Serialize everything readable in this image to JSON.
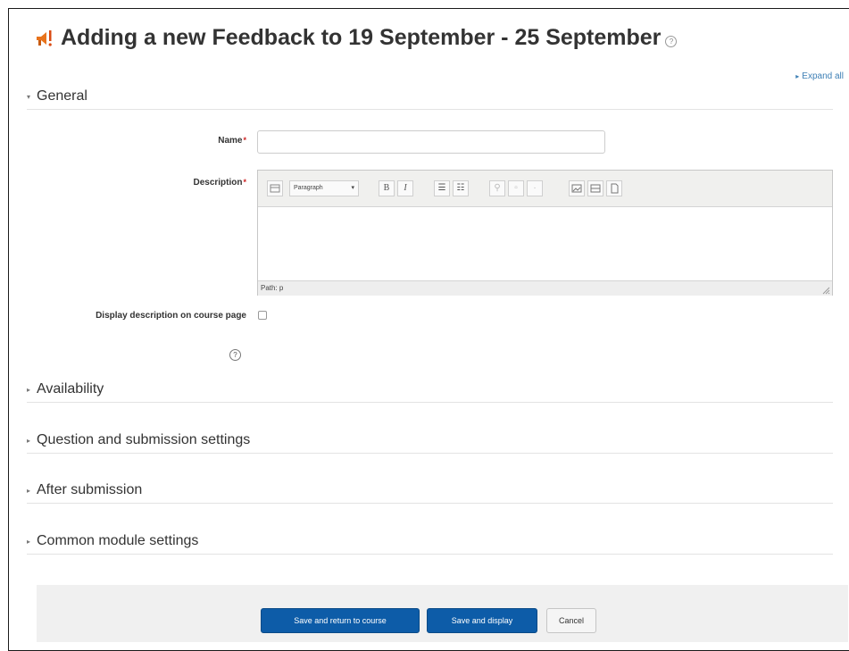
{
  "page": {
    "title": "Adding a new Feedback to 19 September - 25 September",
    "expand_all": "Expand all"
  },
  "sections": {
    "general": "General",
    "availability": "Availability",
    "question_submission": "Question and submission settings",
    "after_submission": "After submission",
    "common_module": "Common module settings"
  },
  "form": {
    "name_label": "Name",
    "name_value": "",
    "description_label": "Description",
    "display_description_label": "Display description on course page",
    "display_description_checked": false,
    "required_marker": "*"
  },
  "editor": {
    "format_select": "Paragraph",
    "status_path": "Path: p",
    "toolbar_icons": [
      "toggle-toolbar-icon",
      "bold-icon",
      "italic-icon",
      "unordered-list-icon",
      "ordered-list-icon",
      "link-icon",
      "unlink-icon",
      "emoticon-icon",
      "image-icon",
      "media-icon",
      "manage-files-icon"
    ]
  },
  "buttons": {
    "save_return": "Save and return to course",
    "save_display": "Save and display",
    "cancel": "Cancel"
  },
  "colors": {
    "primary": "#0d5ca8",
    "link": "#3d7fb5",
    "required": "#cc2222"
  }
}
